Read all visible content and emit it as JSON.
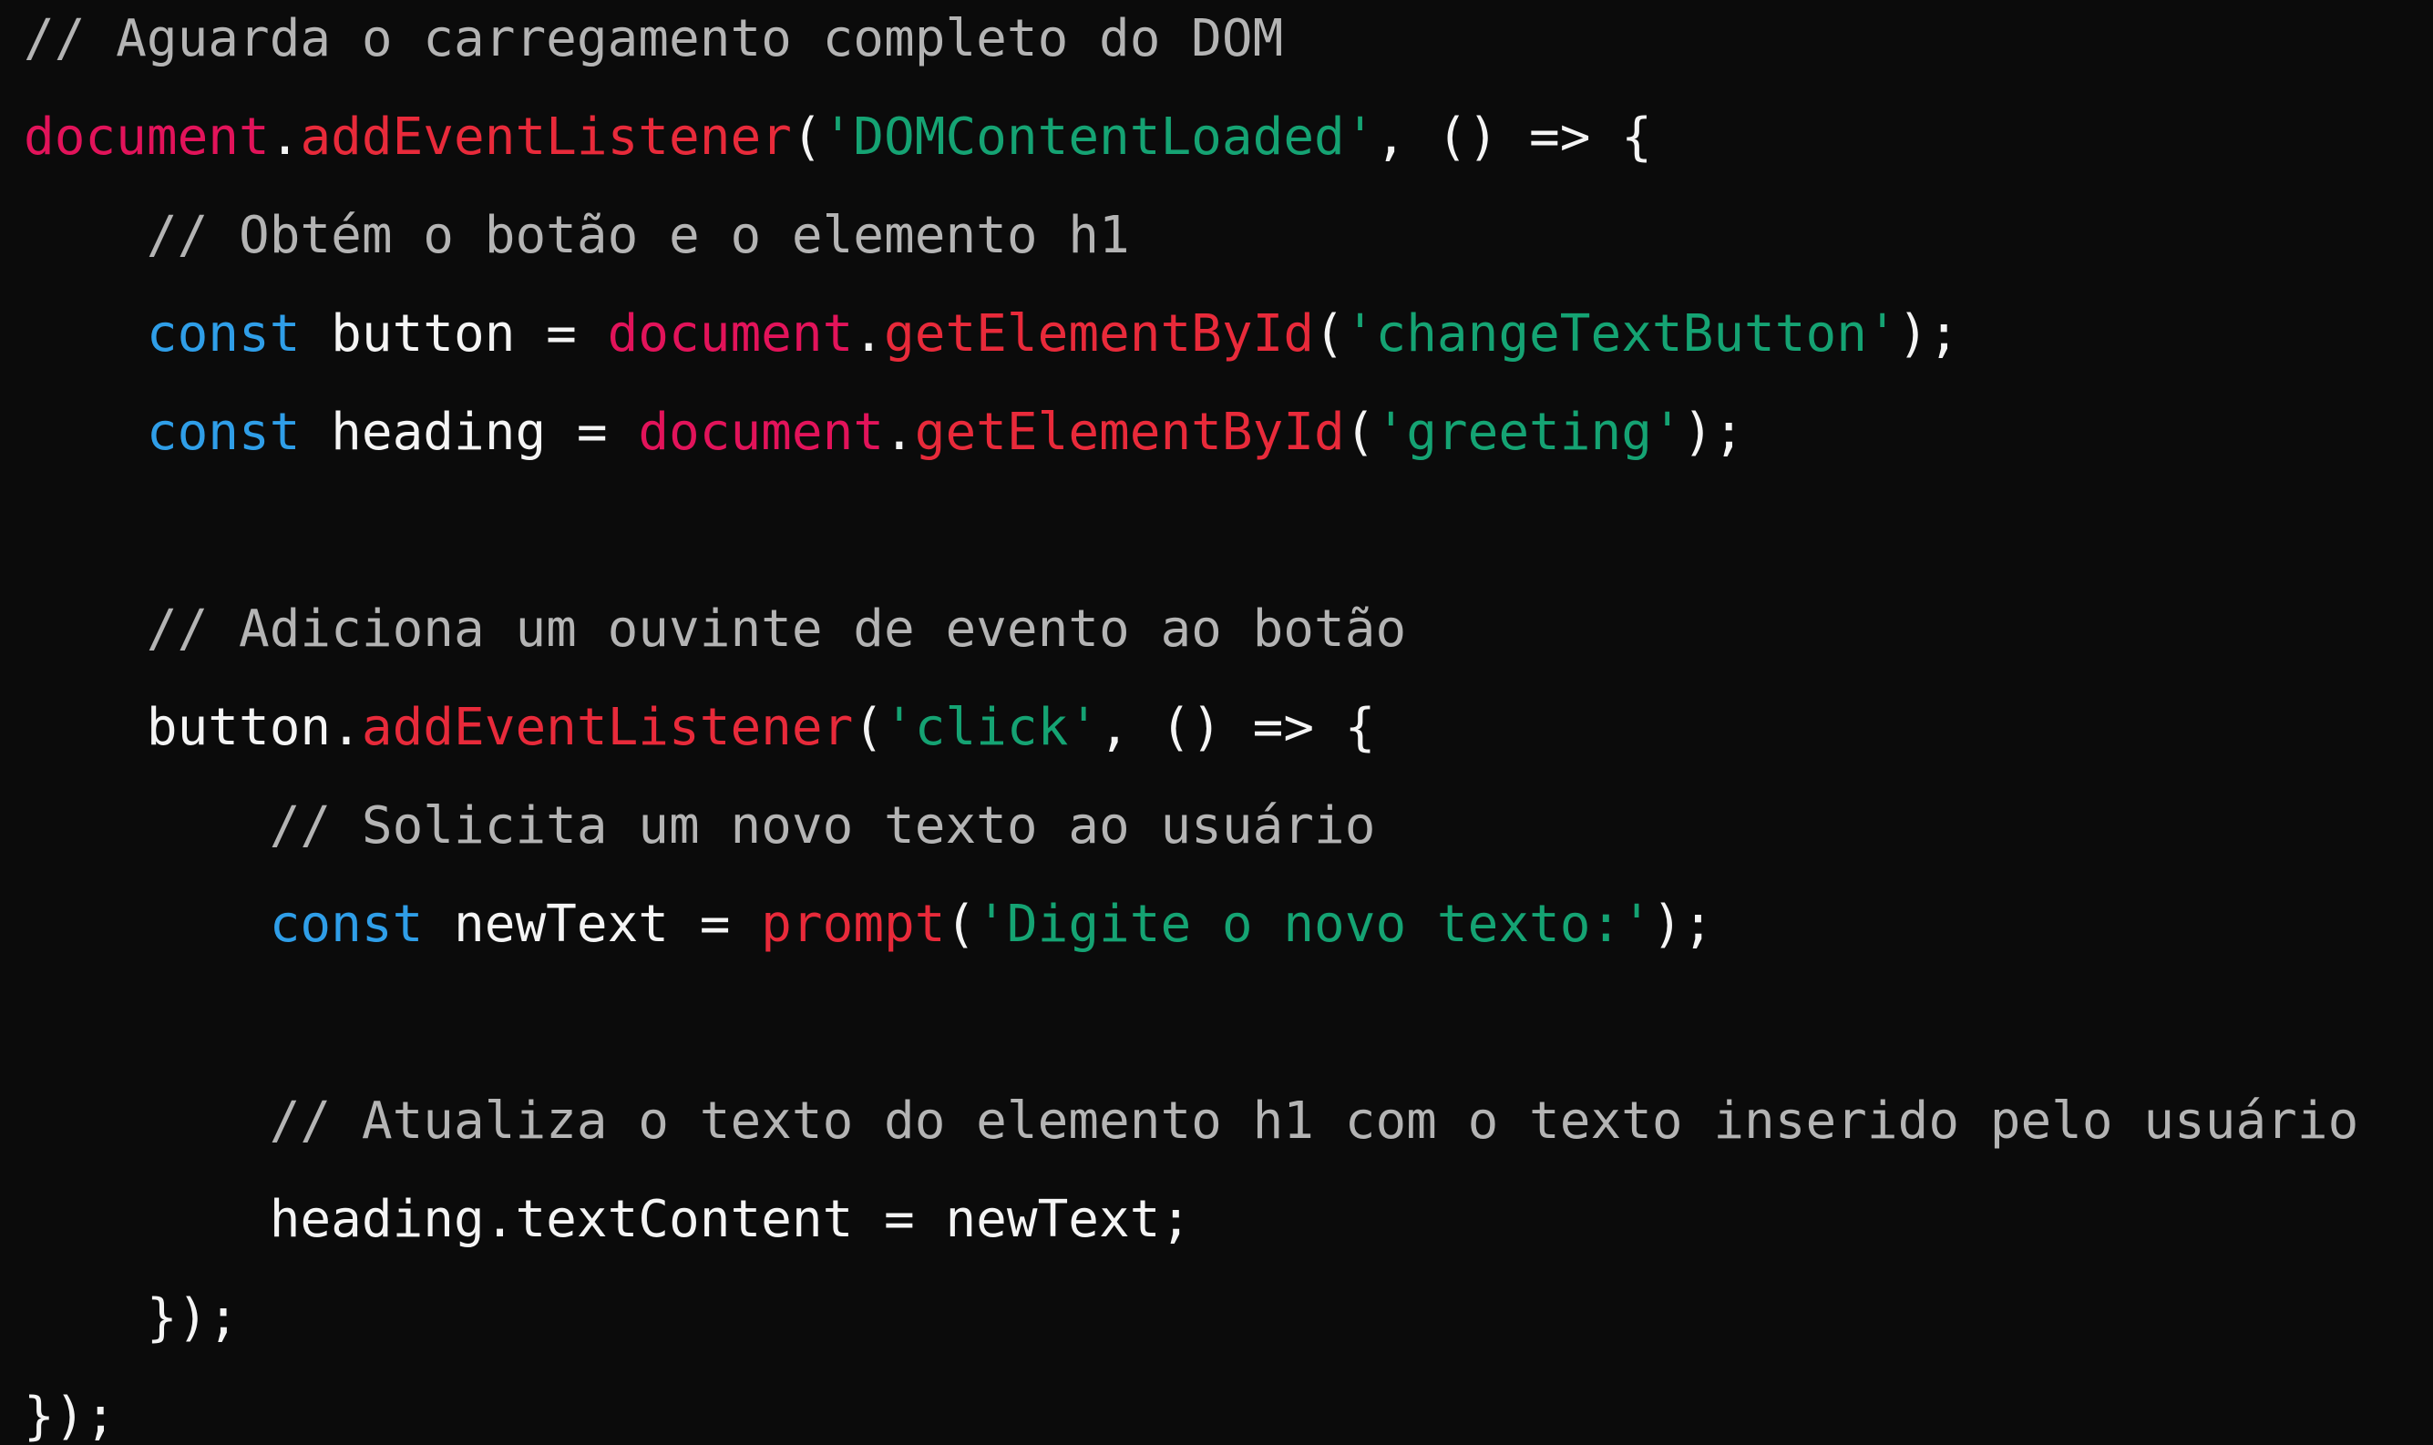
{
  "code": {
    "language": "javascript",
    "colors": {
      "background": "#0b0b0b",
      "comment": "#b4b4b4",
      "object": "#e2135a",
      "method": "#e82a3a",
      "string": "#15a373",
      "keyword": "#2f9ee8",
      "plain": "#f4f4f4"
    },
    "lines": [
      [
        {
          "t": "comment",
          "v": "// Aguarda o carregamento completo do DOM"
        }
      ],
      [
        {
          "t": "object",
          "v": "document"
        },
        {
          "t": "punct",
          "v": "."
        },
        {
          "t": "method",
          "v": "addEventListener"
        },
        {
          "t": "punct",
          "v": "("
        },
        {
          "t": "string",
          "v": "'DOMContentLoaded'"
        },
        {
          "t": "punct",
          "v": ", () => {"
        }
      ],
      [
        {
          "t": "comment",
          "v": "    // Obtém o botão e o elemento h1"
        }
      ],
      [
        {
          "t": "plain",
          "v": "    "
        },
        {
          "t": "keyword",
          "v": "const"
        },
        {
          "t": "plain",
          "v": " button = "
        },
        {
          "t": "object",
          "v": "document"
        },
        {
          "t": "punct",
          "v": "."
        },
        {
          "t": "method",
          "v": "getElementById"
        },
        {
          "t": "punct",
          "v": "("
        },
        {
          "t": "string",
          "v": "'changeTextButton'"
        },
        {
          "t": "punct",
          "v": ");"
        }
      ],
      [
        {
          "t": "plain",
          "v": "    "
        },
        {
          "t": "keyword",
          "v": "const"
        },
        {
          "t": "plain",
          "v": " heading = "
        },
        {
          "t": "object",
          "v": "document"
        },
        {
          "t": "punct",
          "v": "."
        },
        {
          "t": "method",
          "v": "getElementById"
        },
        {
          "t": "punct",
          "v": "("
        },
        {
          "t": "string",
          "v": "'greeting'"
        },
        {
          "t": "punct",
          "v": ");"
        }
      ],
      [],
      [
        {
          "t": "comment",
          "v": "    // Adiciona um ouvinte de evento ao botão"
        }
      ],
      [
        {
          "t": "plain",
          "v": "    button."
        },
        {
          "t": "method",
          "v": "addEventListener"
        },
        {
          "t": "punct",
          "v": "("
        },
        {
          "t": "string",
          "v": "'click'"
        },
        {
          "t": "punct",
          "v": ", () => {"
        }
      ],
      [
        {
          "t": "comment",
          "v": "        // Solicita um novo texto ao usuário"
        }
      ],
      [
        {
          "t": "plain",
          "v": "        "
        },
        {
          "t": "keyword",
          "v": "const"
        },
        {
          "t": "plain",
          "v": " newText = "
        },
        {
          "t": "method",
          "v": "prompt"
        },
        {
          "t": "punct",
          "v": "("
        },
        {
          "t": "string",
          "v": "'Digite o novo texto:'"
        },
        {
          "t": "punct",
          "v": ");"
        }
      ],
      [],
      [
        {
          "t": "comment",
          "v": "        // Atualiza o texto do elemento h1 com o texto inserido pelo usuário"
        }
      ],
      [
        {
          "t": "plain",
          "v": "        heading.textContent = newText;"
        }
      ],
      [
        {
          "t": "punct",
          "v": "    });"
        }
      ],
      [
        {
          "t": "punct",
          "v": "});"
        }
      ]
    ]
  }
}
